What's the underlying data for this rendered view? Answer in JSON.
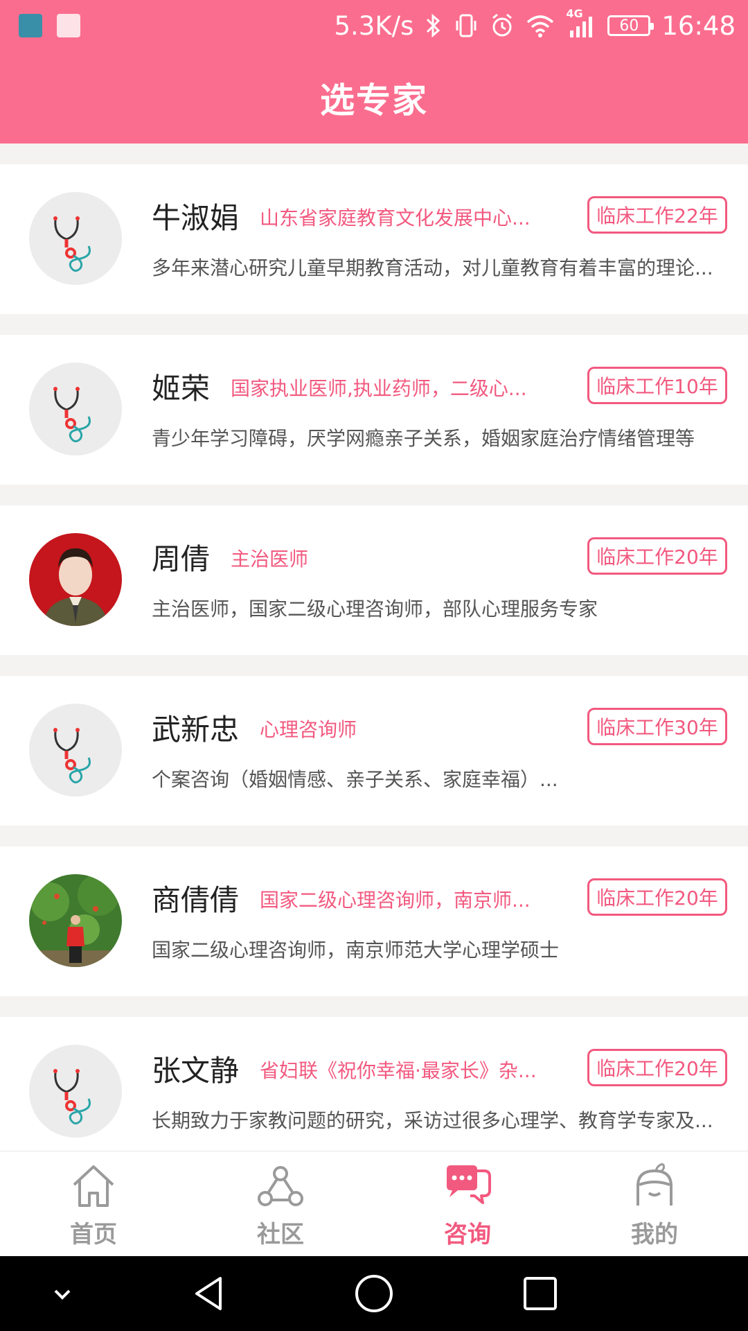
{
  "status_bar": {
    "network_speed": "5.3K/s",
    "signal_label": "4G",
    "battery": "60",
    "time": "16:48"
  },
  "header": {
    "title": "选专家"
  },
  "experts": [
    {
      "name": "牛淑娟",
      "subtitle": "山东省家庭教育文化发展中心...",
      "badge": "临床工作22年",
      "desc": "多年来潜心研究儿童早期教育活动，对儿童教育有着丰富的理论...",
      "avatar": "stethoscope-placeholder"
    },
    {
      "name": "姬荣",
      "subtitle": "国家执业医师,执业药师，二级心...",
      "badge": "临床工作10年",
      "desc": "青少年学习障碍，厌学网瘾亲子关系，婚姻家庭治疗情绪管理等",
      "avatar": "stethoscope-placeholder"
    },
    {
      "name": "周倩",
      "subtitle": "主治医师",
      "badge": "临床工作20年",
      "desc": "主治医师，国家二级心理咨询师，部队心理服务专家",
      "avatar": "photo-portrait-red-background"
    },
    {
      "name": "武新忠",
      "subtitle": "心理咨询师",
      "badge": "临床工作30年",
      "desc": "个案咨询（婚姻情感、亲子关系、家庭幸福）...",
      "avatar": "stethoscope-placeholder"
    },
    {
      "name": "商倩倩",
      "subtitle": "国家二级心理咨询师，南京师...",
      "badge": "临床工作20年",
      "desc": "国家二级心理咨询师，南京师范大学心理学硕士",
      "avatar": "photo-outdoor-greenery"
    },
    {
      "name": "张文静",
      "subtitle": "省妇联《祝你幸福·最家长》杂...",
      "badge": "临床工作20年",
      "desc": "长期致力于家教问题的研究，采访过很多心理学、教育学专家及...",
      "avatar": "stethoscope-placeholder"
    }
  ],
  "tabbar": {
    "tabs": [
      {
        "label": "首页",
        "icon": "home-icon",
        "active": false
      },
      {
        "label": "社区",
        "icon": "community-icon",
        "active": false
      },
      {
        "label": "咨询",
        "icon": "chat-icon",
        "active": true
      },
      {
        "label": "我的",
        "icon": "profile-icon",
        "active": false
      }
    ]
  },
  "colors": {
    "header": "#fb6d8e",
    "accent": "#f2597f",
    "tab_inactive": "#9a9a9a"
  }
}
